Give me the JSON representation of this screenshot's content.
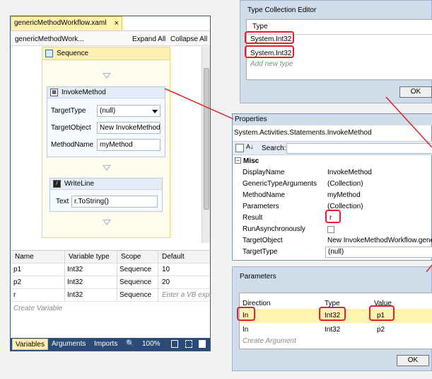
{
  "designer": {
    "tab_title": "genericMethodWorkflow.xaml",
    "tab_close": "×",
    "breadcrumb": "genericMethodWork...",
    "expand_all": "Expand All",
    "collapse_all": "Collapse All",
    "sequence_label": "Sequence",
    "invoke": {
      "label": "InvokeMethod",
      "target_type_label": "TargetType",
      "target_type_value": "(null)",
      "target_object_label": "TargetObject",
      "target_object_value": "New InvokeMethod",
      "method_name_label": "MethodName",
      "method_name_value": "myMethod"
    },
    "writeline": {
      "label": "WriteLine",
      "text_label": "Text",
      "text_value": "r.ToString()"
    },
    "variables": {
      "headers": [
        "Name",
        "Variable type",
        "Scope",
        "Default"
      ],
      "rows": [
        {
          "name": "p1",
          "type": "Int32",
          "scope": "Sequence",
          "default": "10"
        },
        {
          "name": "p2",
          "type": "Int32",
          "scope": "Sequence",
          "default": "20"
        },
        {
          "name": "r",
          "type": "Int32",
          "scope": "Sequence",
          "default": "Enter a VB expr"
        }
      ],
      "create": "Create Variable"
    },
    "bottom_tabs": {
      "variables": "Variables",
      "arguments": "Arguments",
      "imports": "Imports",
      "zoom": "100%"
    }
  },
  "type_editor": {
    "title": "Type Collection Editor",
    "header": "Type",
    "items": [
      "System.Int32",
      "System.Int32"
    ],
    "add_new": "Add new type",
    "ok": "OK"
  },
  "properties": {
    "title": "Properties",
    "object_type": "System.Activities.Statements.InvokeMethod",
    "search_label": "Search:",
    "category": "Misc",
    "rows": [
      {
        "name": "DisplayName",
        "value": "InvokeMethod"
      },
      {
        "name": "GenericTypeArguments",
        "value": "(Collection)"
      },
      {
        "name": "MethodName",
        "value": "myMethod"
      },
      {
        "name": "Parameters",
        "value": "(Collection)"
      },
      {
        "name": "Result",
        "value": "r"
      },
      {
        "name": "RunAsynchronously",
        "value": ""
      },
      {
        "name": "TargetObject",
        "value": "New InvokeMethodWorkflow.gene"
      },
      {
        "name": "TargetType",
        "value": "(null)"
      }
    ]
  },
  "parameters": {
    "title": "Parameters",
    "headers": [
      "Direction",
      "Type",
      "Value"
    ],
    "rows": [
      {
        "direction": "In",
        "type": "Int32",
        "value": "p1"
      },
      {
        "direction": "In",
        "type": "Int32",
        "value": "p2"
      }
    ],
    "create": "Create Argument",
    "ok": "OK"
  },
  "colors": {
    "highlight": "#e0202a",
    "accent": "#2b4a78",
    "selection": "#fff3b0"
  }
}
